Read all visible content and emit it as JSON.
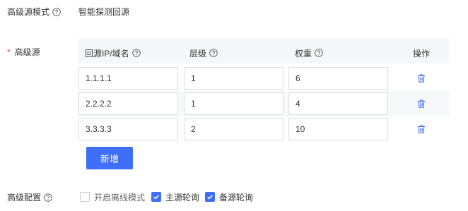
{
  "mode": {
    "label": "高级源模式",
    "value": "智能探测回源"
  },
  "origin": {
    "label": "高级源",
    "required_mark": "*",
    "columns": {
      "host": "回源IP/域名",
      "level": "层级",
      "weight": "权重",
      "action": "操作"
    },
    "rows": [
      {
        "host": "1.1.1.1",
        "level": "1",
        "weight": "6"
      },
      {
        "host": "2.2.2.2",
        "level": "1",
        "weight": "4"
      },
      {
        "host": "3.3.3.3",
        "level": "2",
        "weight": "10"
      }
    ],
    "add_button": "新增"
  },
  "config": {
    "label": "高级配置",
    "options": [
      {
        "label": "开启离线模式",
        "checked": false
      },
      {
        "label": "主源轮询",
        "checked": true
      },
      {
        "label": "备源轮询",
        "checked": true
      }
    ]
  },
  "colors": {
    "primary": "#3f6ef7",
    "required": "#e34d59",
    "header_bg": "#f5f7fa"
  },
  "icons": {
    "help": "question-circle-icon",
    "delete": "trash-icon",
    "check": "check-icon"
  }
}
